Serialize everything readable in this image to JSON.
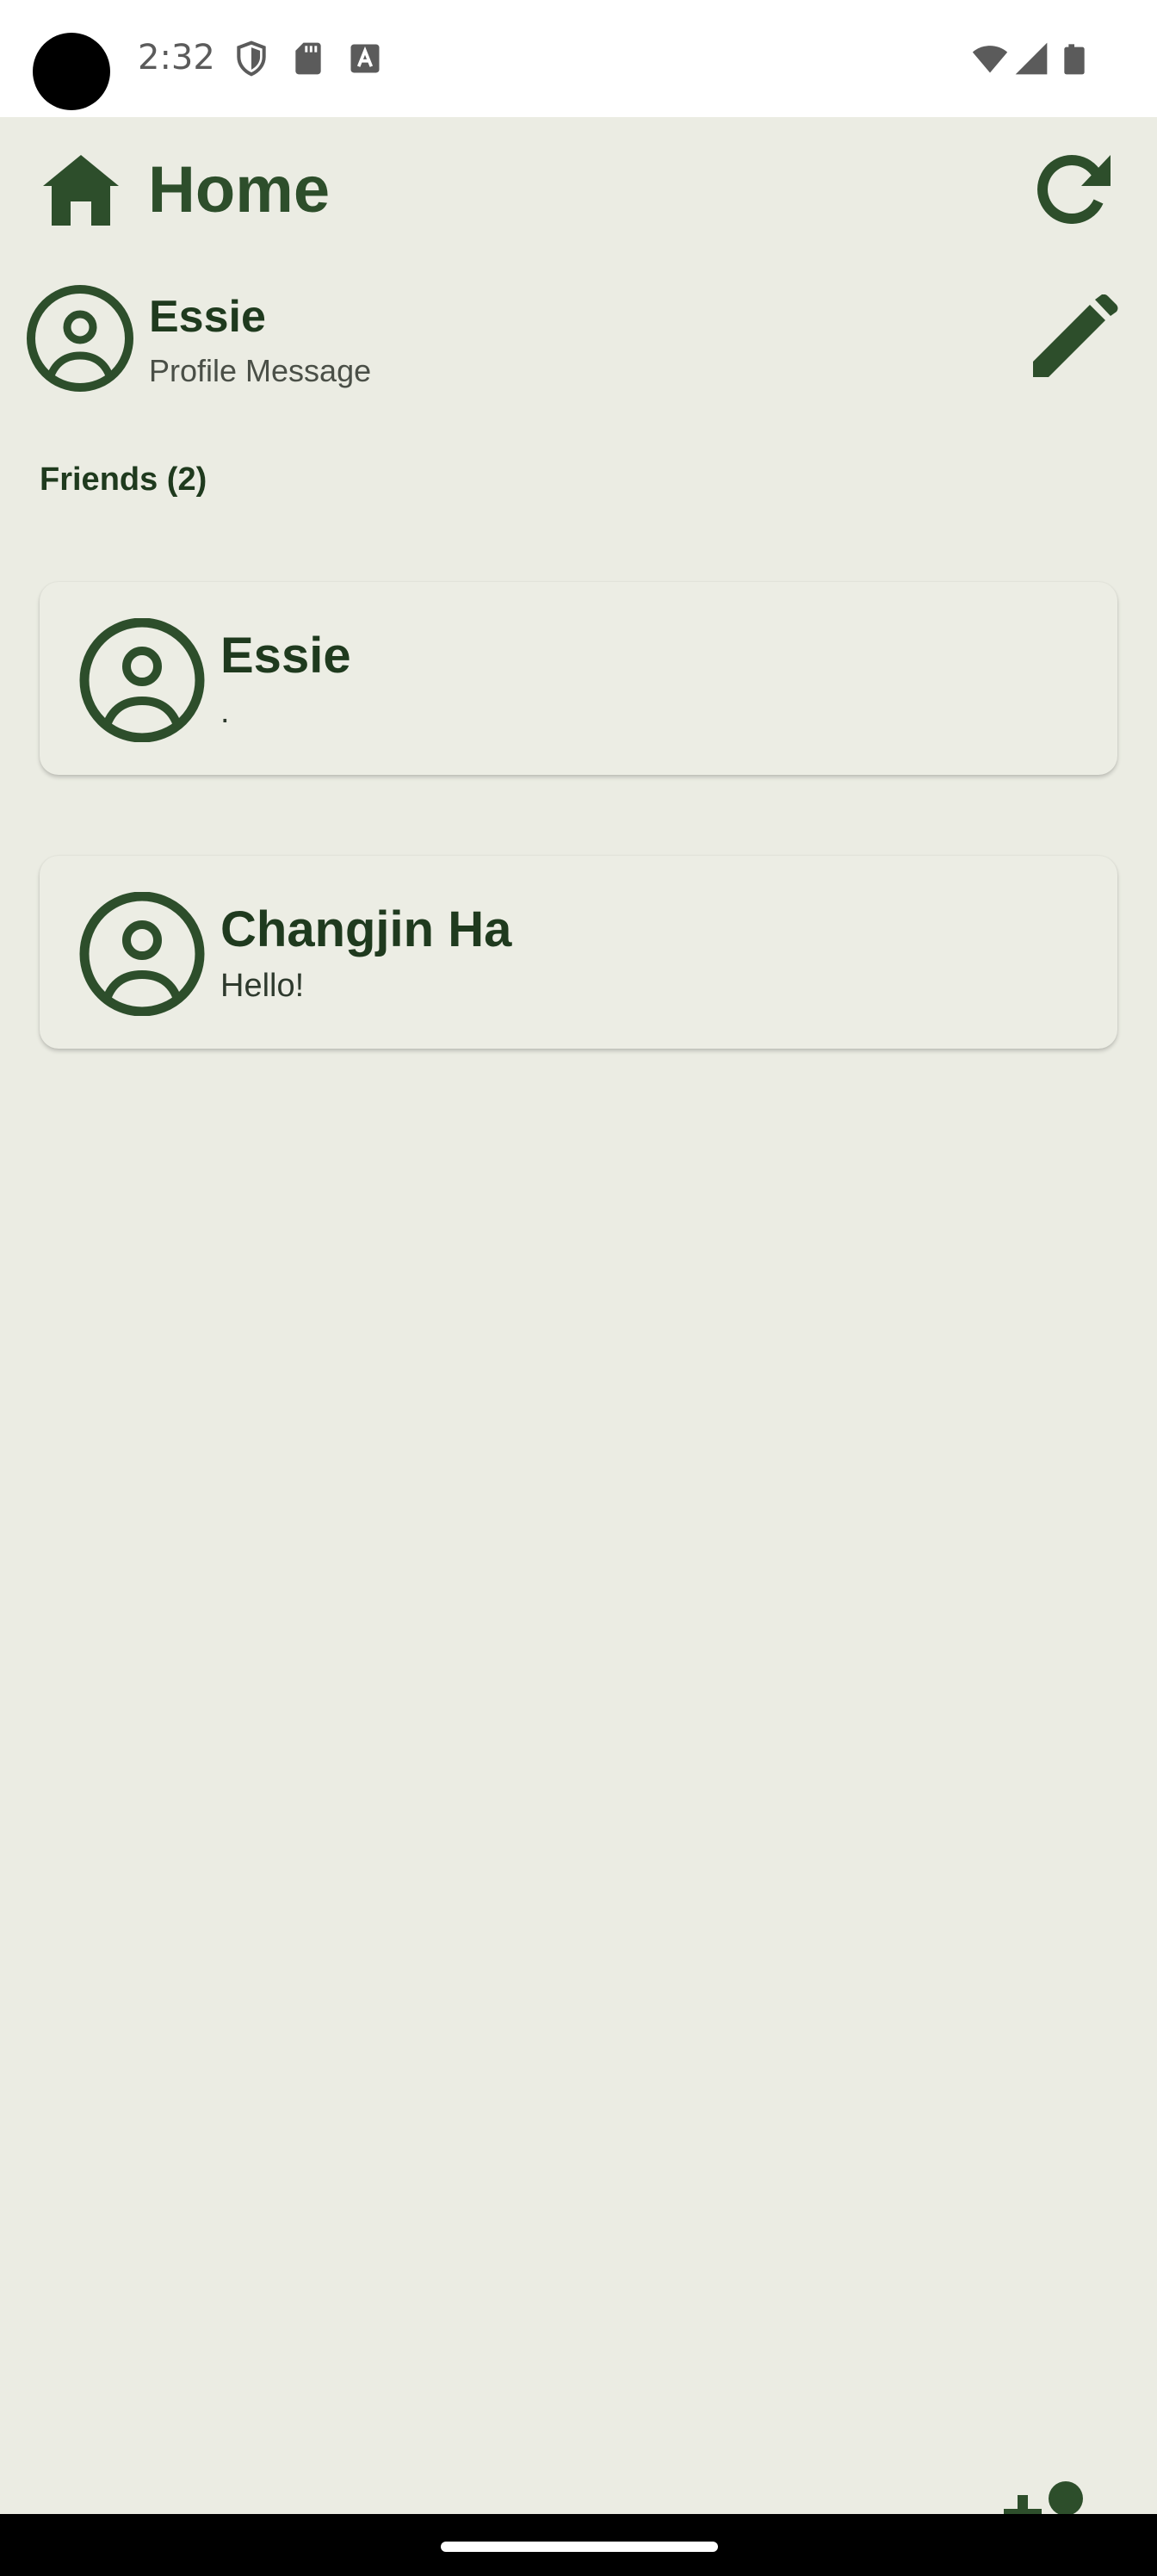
{
  "status_bar": {
    "time": "2:32",
    "icons": [
      "shield-icon",
      "sd-card-icon",
      "font-a-icon",
      "wifi-icon",
      "cell-signal-icon",
      "battery-icon"
    ]
  },
  "header": {
    "title": "Home",
    "home_icon": "home-icon",
    "refresh_icon": "refresh-icon"
  },
  "profile": {
    "name": "Essie",
    "message": "Profile Message",
    "avatar_icon": "account-circle-icon",
    "edit_icon": "pencil-icon"
  },
  "friends": {
    "header": "Friends (2)",
    "items": [
      {
        "name": "Essie",
        "message": "."
      },
      {
        "name": "Changjin Ha",
        "message": "Hello!"
      }
    ]
  },
  "colors": {
    "background": "#ebece3",
    "accent": "#2d4e2b",
    "text_dark": "#1f3a1e",
    "status_bar": "#ffffff"
  }
}
